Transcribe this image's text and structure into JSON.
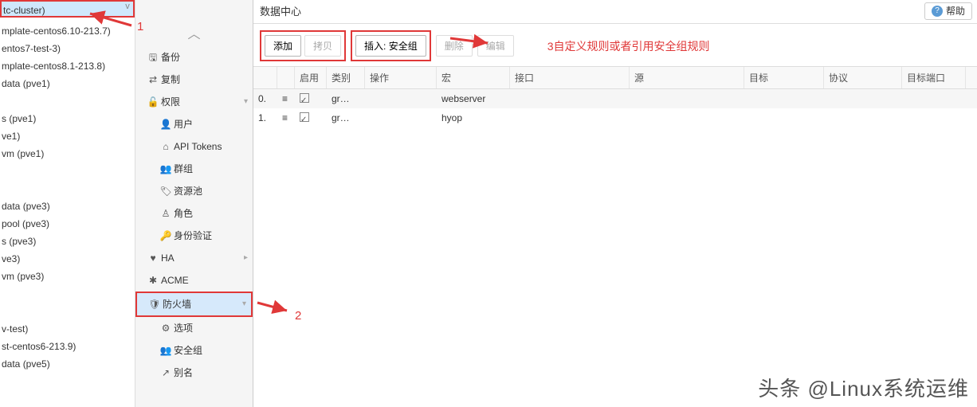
{
  "tree": {
    "selected": "tc-cluster)",
    "items": [
      "mplate-centos6.10-213.7)",
      "entos7-test-3)",
      "mplate-centos8.1-213.8)",
      "data (pve1)",
      "",
      "s (pve1)",
      "ve1)",
      "vm (pve1)",
      "",
      "",
      "data (pve3)",
      "pool (pve3)",
      "s (pve3)",
      "ve3)",
      "vm (pve3)",
      "",
      "",
      "v-test)",
      "st-centos6-213.9)",
      "data (pve5)"
    ]
  },
  "nav": {
    "backup": "备份",
    "copy": "复制",
    "perm": "权限",
    "user": "用户",
    "api": "API Tokens",
    "group": "群组",
    "pool": "资源池",
    "role": "角色",
    "auth": "身份验证",
    "ha": "HA",
    "acme": "ACME",
    "firewall": "防火墙",
    "options": "选项",
    "secgrp": "安全组",
    "alias": "别名"
  },
  "title": "数据中心",
  "help": "帮助",
  "toolbar": {
    "add": "添加",
    "mid": "拷贝",
    "insert": "插入: 安全组",
    "del": "删除",
    "edit": "编辑"
  },
  "cols": {
    "enable": "启用",
    "type": "类别",
    "action": "操作",
    "macro": "宏",
    "iface": "接口",
    "src": "源",
    "target": "目标",
    "proto": "协议",
    "dport": "目标端口"
  },
  "rows": [
    {
      "n": "0.",
      "type": "gr…",
      "macro": "webserver"
    },
    {
      "n": "1.",
      "type": "gr…",
      "macro": "hyop"
    }
  ],
  "annots": {
    "a1": "1",
    "a2": "2",
    "a3": "3自定义规则或者引用安全组规则"
  },
  "watermark": "头条 @Linux系统运维"
}
